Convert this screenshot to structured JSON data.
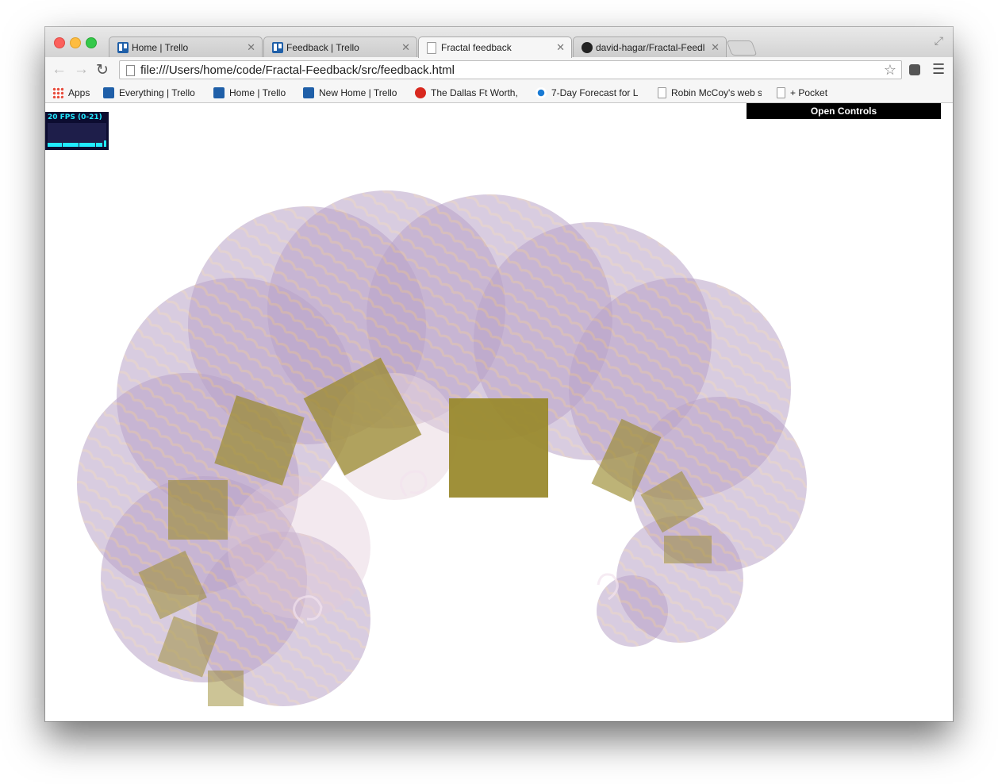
{
  "tabs": [
    {
      "title": "Home | Trello",
      "icon": "trello-icon"
    },
    {
      "title": "Feedback | Trello",
      "icon": "trello-icon"
    },
    {
      "title": "Fractal feedback",
      "icon": "document-icon",
      "active": true
    },
    {
      "title": "david-hagar/Fractal-Feedl",
      "icon": "github-icon"
    }
  ],
  "toolbar": {
    "url": "file:///Users/home/code/Fractal-Feedback/src/feedback.html"
  },
  "bookmarks": [
    {
      "label": "Apps",
      "icon": "apps-grid-icon"
    },
    {
      "label": "Everything | Trello",
      "icon": "trello-icon"
    },
    {
      "label": "Home | Trello",
      "icon": "trello-icon"
    },
    {
      "label": "New Home | Trello",
      "icon": "trello-icon"
    },
    {
      "label": "The Dallas Ft Worth,",
      "icon": "dallas-icon"
    },
    {
      "label": "7-Day Forecast for L",
      "icon": "noaa-icon"
    },
    {
      "label": "Robin McCoy's web s",
      "icon": "document-icon"
    },
    {
      "label": "+ Pocket",
      "icon": "document-icon"
    }
  ],
  "stats": {
    "fps_label": "20 FPS (0-21)"
  },
  "controls": {
    "open_label": "Open Controls"
  },
  "colors": {
    "petal": "#8e6aa8",
    "square": "#9a8a2e",
    "stats_text": "#22eaff",
    "stats_bg": "#0c0c30"
  }
}
